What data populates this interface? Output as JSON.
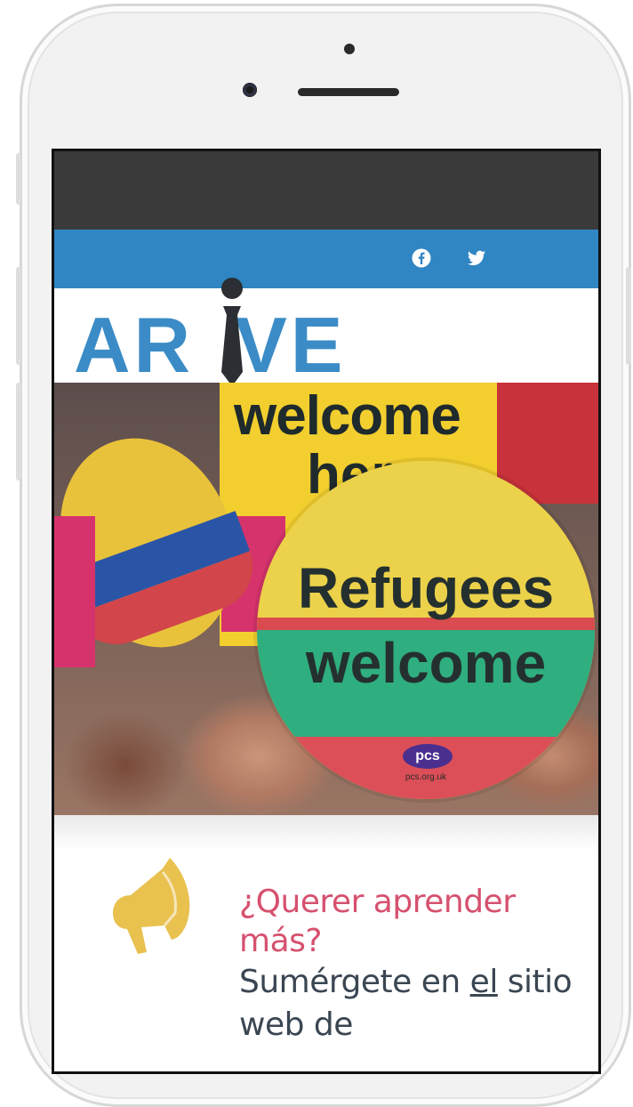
{
  "site": {
    "logo_text": "ARIVE",
    "brand_color": "#2f86c3",
    "accent_color": "#d6516f"
  },
  "social": [
    {
      "icon": "facebook-icon"
    },
    {
      "icon": "twitter-icon"
    }
  ],
  "hero": {
    "sign1_line1": "welcome",
    "sign1_line2": "here",
    "disc_line1": "Refugees",
    "disc_line2": "welcome",
    "pcs_badge": "pcs",
    "pcs_url": "pcs.org.uk"
  },
  "cta": {
    "icon": "megaphone-icon",
    "heading": "¿Querer aprender más?",
    "text_prefix": "Sumérgete en ",
    "link_text": "el",
    "text_suffix": " sitio web de"
  }
}
